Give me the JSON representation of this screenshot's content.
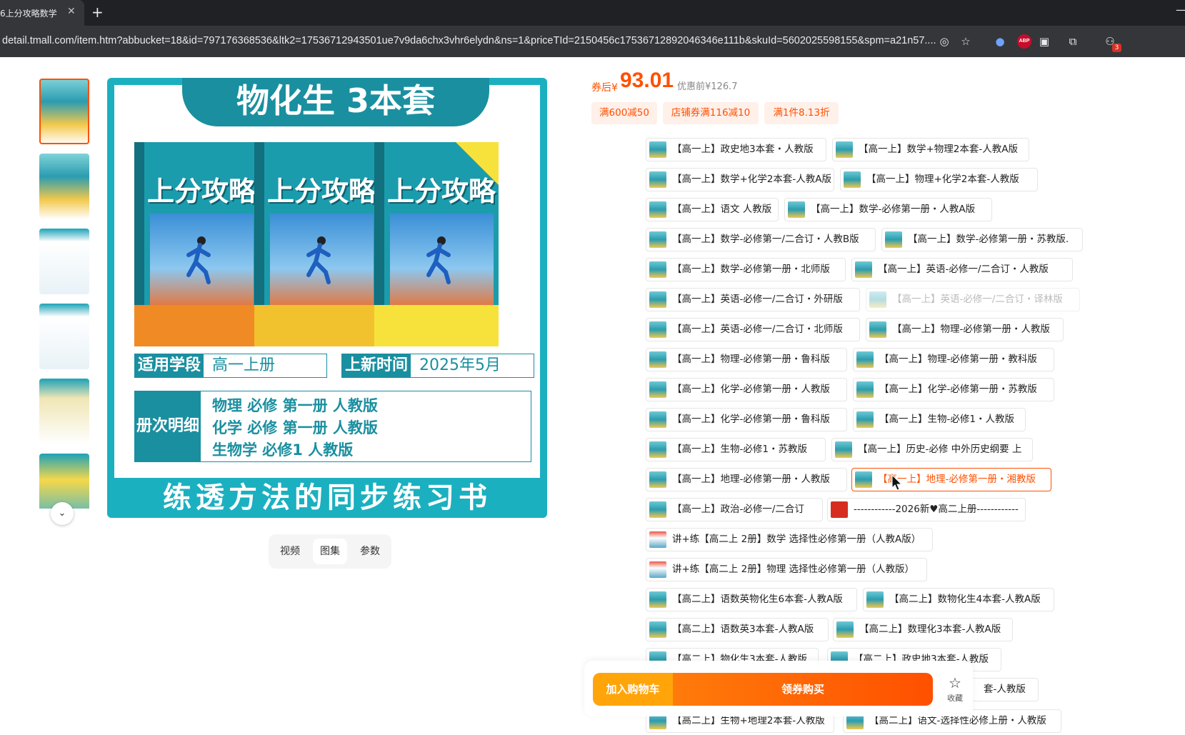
{
  "browser": {
    "tab_title": "6上分攻略数学",
    "tab_close": "✕",
    "new_tab": "+",
    "url": "detail.tmall.com/item.htm?abbucket=18&id=797176368536&ltk2=17536712943501ue7v9da6chx3vhr6elydn&ns=1&priceTId=2150456c17536712892046346e111b&skuId=5602025598155&spm=a21n57....",
    "extension_badge": "3"
  },
  "gallery": {
    "thumb_count": 6,
    "main_image": {
      "title": "物化生 3本套",
      "book_title": "上分攻略",
      "stage_label": "适用学段",
      "stage_value": "高一上册",
      "date_label": "上新时间",
      "date_value": "2025年5月",
      "details_label": "册次明细",
      "details": [
        "物理  必修  第一册  人教版",
        "化学  必修  第一册  人教版",
        "生物学  必修1  人教版"
      ],
      "slogan": "练透方法的同步练习书"
    },
    "media_tabs": [
      "视频",
      "图集",
      "参数"
    ],
    "active_media_tab": "图集"
  },
  "price": {
    "prefix": "券后¥",
    "value": "93.01",
    "original": "优惠前¥126.7"
  },
  "promos": [
    "满600减50",
    "店铺券满116减10",
    "满1件8.13折"
  ],
  "skus": [
    "【高一上】政史地3本套・人教版",
    "【高一上】数学+物理2本套-人教A版",
    "【高一上】数学+化学2本套-人教A版",
    "【高一上】物理+化学2本套-人教版",
    "【高一上】语文 人教版",
    "【高一上】数学-必修第一册・人教A版",
    "【高一上】数学-必修第一/二合订・人教B版",
    "【高一上】数学-必修第一册・苏教版.",
    "【高一上】数学-必修第一册・北师版",
    "【高一上】英语-必修一/二合订・人教版",
    "【高一上】英语-必修一/二合订・外研版",
    "【高一上】英语-必修一/二合订・译林版",
    "【高一上】英语-必修一/二合订・北师版",
    "【高一上】物理-必修第一册・人教版",
    "【高一上】物理-必修第一册・鲁科版",
    "【高一上】物理-必修第一册・教科版",
    "【高一上】化学-必修第一册・人教版",
    "【高一上】化学-必修第一册・苏教版",
    "【高一上】化学-必修第一册・鲁科版",
    "【高一上】生物-必修1・人教版",
    "【高一上】生物-必修1・苏教版",
    "【高一上】历史-必修 中外历史纲要 上",
    "【高一上】地理-必修第一册・人教版",
    "【高一上】地理-必修第一册・湘教版",
    "【高一上】政治-必修一/二合订",
    "------------2026新♥高二上册------------",
    "讲+练【高二上 2册】数学 选择性必修第一册（人教A版）",
    "讲+练【高二上 2册】物理 选择性必修第一册（人教版）",
    "【高二上】语数英物化生6本套-人教A版",
    "【高二上】数物化生4本套-人教A版",
    "【高二上】语数英3本套-人教A版",
    "【高二上】数理化3本套-人教A版",
    "【高二上】物化生3本套-人教版",
    "【高二上】政史地3本套-人教版",
    "套-人教版",
    "【高二上】生物+地理2本套-人教版",
    "【高二上】语文-选择性必修上册・人教版"
  ],
  "sku_state": {
    "selected": "【高一上】地理-必修第一册・湘教版",
    "disabled": "【高一上】英语-必修一/二合订・译林版"
  },
  "actions": {
    "add_to_cart": "加入购物车",
    "buy_with_coupon": "领券购买",
    "favorite": "收藏"
  },
  "colors": {
    "accent": "#ff5000",
    "cart": "#ffa50a",
    "book_teal": "#1a8fa0"
  }
}
